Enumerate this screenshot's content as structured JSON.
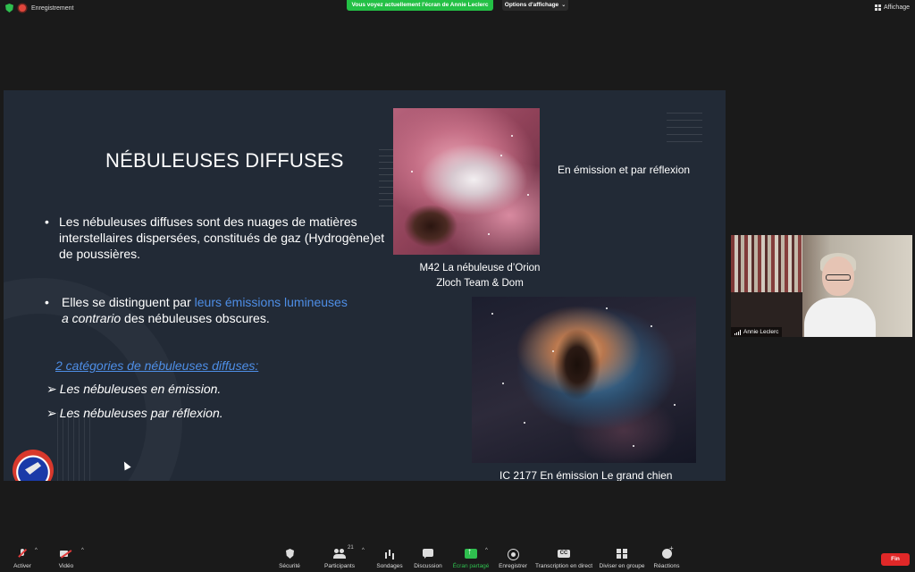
{
  "topbar": {
    "recording_label": "Enregistrement",
    "share_banner": "Vous voyez actuellement l'écran de Annie Leclerc",
    "view_options_label": "Options d'affichage",
    "display_label": "Affichage"
  },
  "slide": {
    "title": "NÉBULEUSES DIFFUSES",
    "bullet1": "Les nébuleuses diffuses sont des nuages de matières interstellaires dispersées, constitués de gaz (Hydrogène)et de poussières.",
    "bullet2_part1": "Elles se distinguent par ",
    "bullet2_highlight": "leurs émissions lumineuses",
    "bullet2_italic": "a contrario",
    "bullet2_part2": " des nébuleuses obscures.",
    "categories_title": "2 catégories de nébuleuses diffuses:",
    "category1": "Les nébuleuses en émission.",
    "category2": "Les nébuleuses par réflexion.",
    "m42_caption_line1": "M42    La nébuleuse d’Orion",
    "m42_caption_line2": "Zloch Team & Dom",
    "emission_reflection_label": "En émission et par réflexion",
    "ic2177_caption": "IC 2177   En émission Le grand chien",
    "bullet_glyph": "•",
    "arrow_glyph": "➢"
  },
  "participant": {
    "name": "Annie Leclerc"
  },
  "toolbar": {
    "mute_label": "Activer",
    "video_label": "Vidéo",
    "security_label": "Sécurité",
    "participants_label": "Participants",
    "participants_count": "21",
    "polls_label": "Sondages",
    "chat_label": "Discussion",
    "share_label": "Écran partagé",
    "record_label": "Enregistrer",
    "transcription_label": "Transcription en direct",
    "breakout_label": "Diviser en groupe",
    "reactions_label": "Réactions",
    "end_label": "Fin",
    "caret": "^"
  },
  "colors": {
    "share_green": "#23c045",
    "end_red": "#e02828",
    "slide_bg": "#222a36",
    "slide_accent_blue": "#4e8ee6"
  }
}
